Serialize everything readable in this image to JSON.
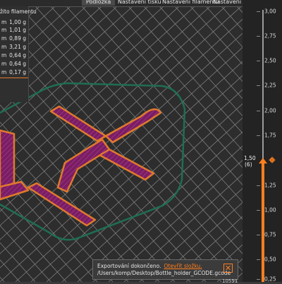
{
  "tabs": [
    {
      "label": "Podložka",
      "active": true
    },
    {
      "label": "Nastavení tisku",
      "active": false
    },
    {
      "label": "Nastavení filamentu",
      "active": false
    },
    {
      "label": "Nastavení tiskárny",
      "active": false
    }
  ],
  "legend": {
    "header": "žito filamentu",
    "rows": [
      {
        "unit": "m",
        "value": "1,00 g"
      },
      {
        "unit": "m",
        "value": "1,01 g"
      },
      {
        "unit": "m",
        "value": "0,89 g"
      },
      {
        "unit": "m",
        "value": "3,21 g"
      },
      {
        "unit": "m",
        "value": "0,64 g"
      },
      {
        "unit": "m",
        "value": "0,64 g"
      },
      {
        "unit": "m",
        "value": "0,17 g"
      }
    ]
  },
  "slider": {
    "ticks": [
      "3,00",
      "2,75",
      "2,50",
      "2,25",
      "2,00",
      "1,75",
      "1,25",
      "1,00",
      "0,75",
      "0,50",
      "0,25"
    ],
    "current_value": "1,50",
    "current_layer": "(6)",
    "current_level_fraction": 0.5
  },
  "toast": {
    "line1": "Exportování dokončeno.",
    "link": "Otevřít složku.",
    "line2": "/Users/komp/Desktop/Bottle_holder_GCODE.gcode"
  },
  "bottom_number": "10551",
  "colors": {
    "accent": "#ff7f1f",
    "model_fill": "#8a1f6a",
    "model_outline": "#e07a2c",
    "perimeter": "#1f7a5a"
  }
}
